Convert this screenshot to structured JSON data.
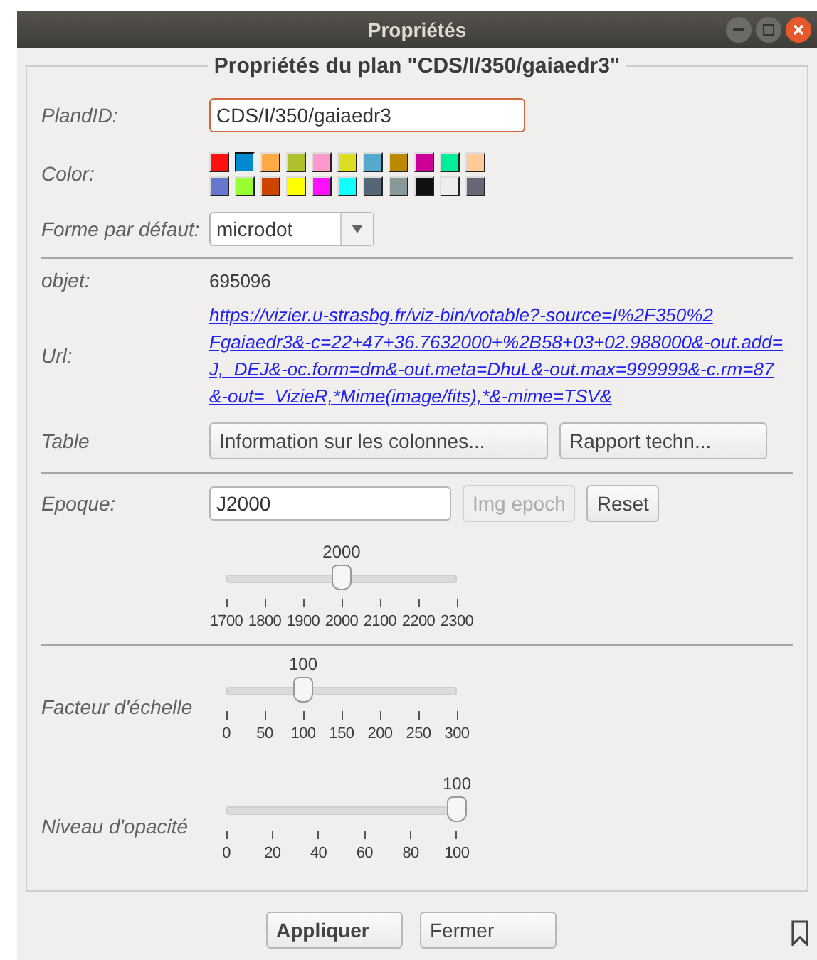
{
  "window": {
    "title": "Propriétés"
  },
  "group": {
    "title": "Propriétés du plan \"CDS/I/350/gaiaedr3\""
  },
  "plan_id": {
    "label": "PlandID:",
    "value": "CDS/I/350/gaiaedr3"
  },
  "color": {
    "label": "Color:",
    "swatches": [
      {
        "color": "#ff1111",
        "selected": false
      },
      {
        "color": "#0088d0",
        "selected": true
      },
      {
        "color": "#ffaa44",
        "selected": false
      },
      {
        "color": "#b0c02a",
        "selected": false
      },
      {
        "color": "#ff99cc",
        "selected": false
      },
      {
        "color": "#dddd22",
        "selected": false
      },
      {
        "color": "#55aacc",
        "selected": false
      },
      {
        "color": "#bb8800",
        "selected": false
      },
      {
        "color": "#cc0099",
        "selected": false
      },
      {
        "color": "#00ee99",
        "selected": false
      },
      {
        "color": "#ffcc99",
        "selected": false
      },
      {
        "color": "#6677cc",
        "selected": false
      },
      {
        "color": "#99ff33",
        "selected": false
      },
      {
        "color": "#cc4400",
        "selected": false
      },
      {
        "color": "#ffff00",
        "selected": false
      },
      {
        "color": "#ff11ff",
        "selected": false
      },
      {
        "color": "#11ffff",
        "selected": false
      },
      {
        "color": "#556677",
        "selected": false
      },
      {
        "color": "#889999",
        "selected": false
      },
      {
        "color": "#111111",
        "selected": false
      },
      {
        "color": "#eeeeee",
        "selected": false
      },
      {
        "color": "#666677",
        "selected": false
      }
    ]
  },
  "default_shape": {
    "label": "Forme par défaut:",
    "value": "microdot"
  },
  "object": {
    "label": "objet:",
    "value": "695096"
  },
  "url": {
    "label": "Url:",
    "lines": [
      "https://vizier.u-strasbg.fr/viz-bin/votable?-source=I%2F350%2",
      "Fgaiaedr3&-c=22+47+36.7632000+%2B58+03+02.988000&-out.add=",
      "J,_DEJ&-oc.form=dm&-out.meta=DhuL&-out.max=999999&-c.rm=87",
      "&-out=_VizieR,*Mime(image/fits),*&-mime=TSV&"
    ]
  },
  "table": {
    "label": "Table",
    "buttons": [
      "Information sur les colonnes...",
      "Rapport techn..."
    ]
  },
  "epoch": {
    "label": "Epoque:",
    "value": "J2000",
    "buttons": [
      {
        "label": "Img epoch",
        "disabled": true
      },
      {
        "label": "Reset",
        "disabled": false
      }
    ],
    "slider": {
      "value": "2000",
      "level": 0.5,
      "ticks": [
        "1700",
        "1800",
        "1900",
        "2000",
        "2100",
        "2200",
        "2300"
      ]
    }
  },
  "scale": {
    "label": "Facteur d'échelle",
    "slider": {
      "value": "100",
      "level": 0.3333,
      "ticks": [
        "0",
        "50",
        "100",
        "150",
        "200",
        "250",
        "300"
      ]
    }
  },
  "opacity": {
    "label": "Niveau d'opacité",
    "slider": {
      "value": "100",
      "level": 1,
      "ticks": [
        "0",
        "20",
        "40",
        "60",
        "80",
        "100"
      ]
    }
  },
  "buttons": [
    {
      "label": "Appliquer",
      "default": true
    },
    {
      "label": "Fermer",
      "default": false
    }
  ]
}
